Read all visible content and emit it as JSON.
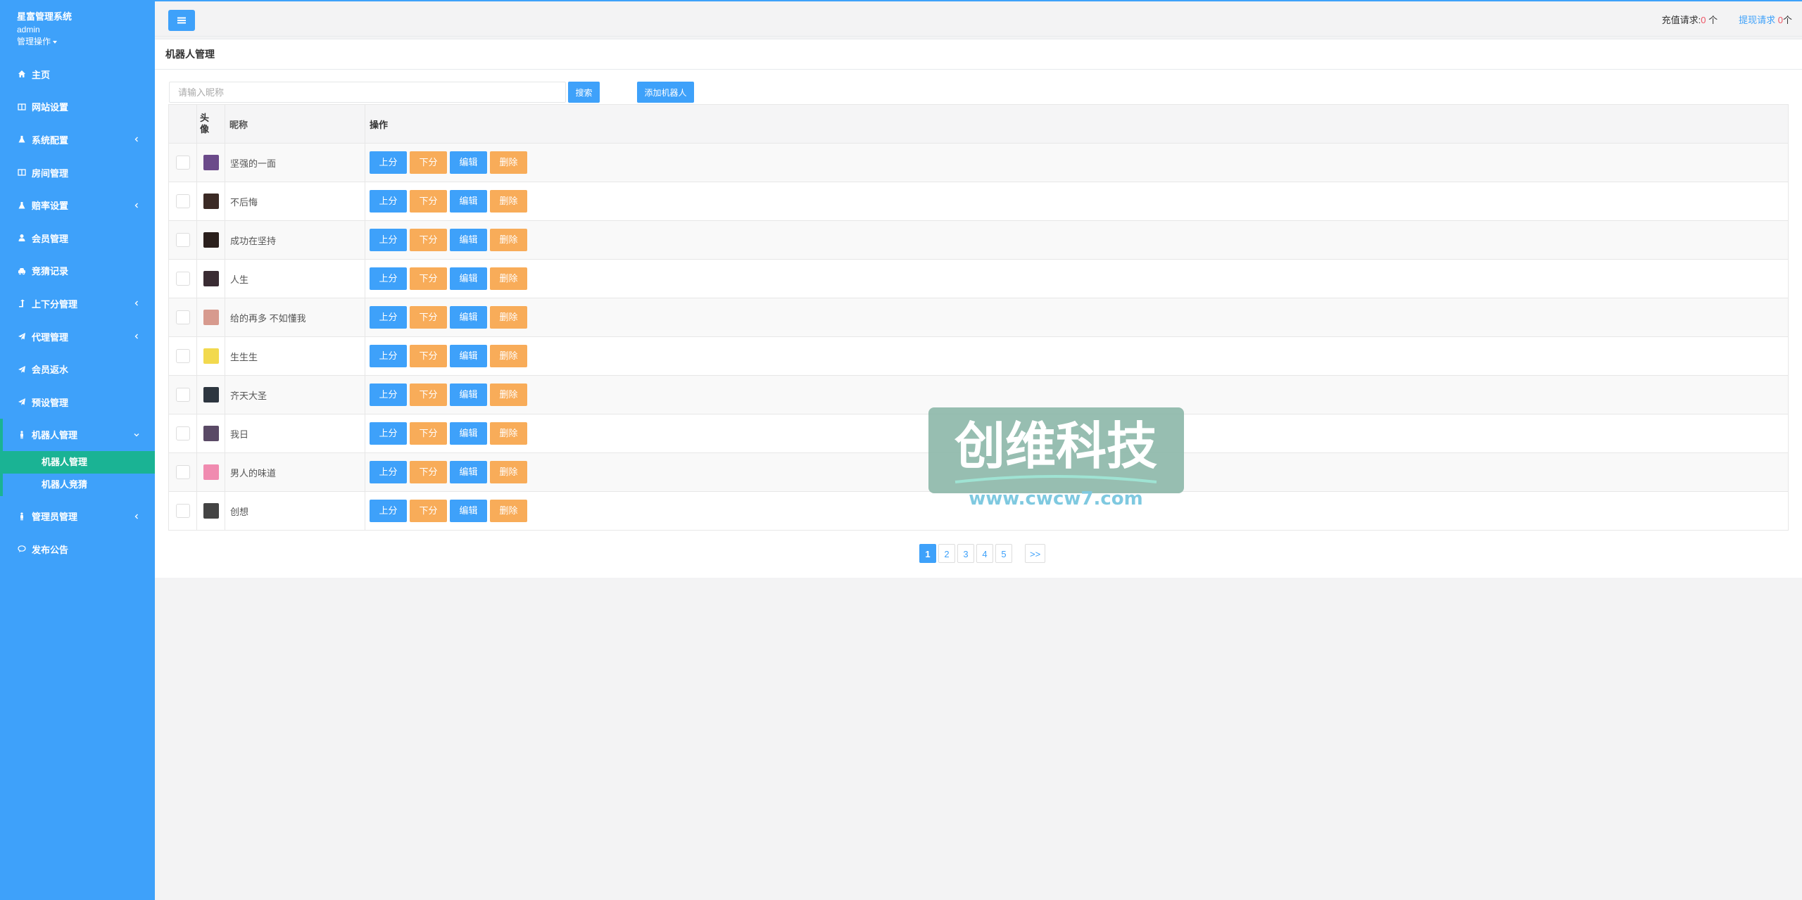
{
  "sidebar": {
    "system_name": "星富管理系统",
    "user": "admin",
    "menu_op": "管理操作",
    "items": [
      {
        "label": "主页",
        "icon": "home-icon",
        "has_arrow": false
      },
      {
        "label": "网站设置",
        "icon": "columns-icon",
        "has_arrow": false
      },
      {
        "label": "系统配置",
        "icon": "flask-icon",
        "has_arrow": true
      },
      {
        "label": "房间管理",
        "icon": "columns-icon",
        "has_arrow": false
      },
      {
        "label": "赔率设置",
        "icon": "flask-icon",
        "has_arrow": true
      },
      {
        "label": "会员管理",
        "icon": "user-icon",
        "has_arrow": false
      },
      {
        "label": "竞猜记录",
        "icon": "car-icon",
        "has_arrow": false
      },
      {
        "label": "上下分管理",
        "icon": "level-up-icon",
        "has_arrow": true
      },
      {
        "label": "代理管理",
        "icon": "paper-plane-icon",
        "has_arrow": true
      },
      {
        "label": "会员返水",
        "icon": "paper-plane-icon",
        "has_arrow": false
      },
      {
        "label": "预设管理",
        "icon": "paper-plane-icon",
        "has_arrow": false
      }
    ],
    "active_item": {
      "label": "机器人管理",
      "icon": "male-icon"
    },
    "sub_items": [
      "机器人管理",
      "机器人竞猜"
    ],
    "after_items": [
      {
        "label": "管理员管理",
        "icon": "male-icon",
        "has_arrow": true
      },
      {
        "label": "发布公告",
        "icon": "comment-icon",
        "has_arrow": false
      }
    ]
  },
  "topbar": {
    "recharge_label": "充值请求:",
    "recharge_count": "0",
    "recharge_unit": "个",
    "withdraw_label": "提现请求",
    "withdraw_count": "0",
    "withdraw_unit": "个"
  },
  "page": {
    "title": "机器人管理",
    "search_placeholder": "请输入昵称",
    "search_button": "搜索",
    "add_button": "添加机器人"
  },
  "table": {
    "headers": {
      "avatar": "头像",
      "nickname": "昵称",
      "actions": "操作"
    },
    "action_labels": {
      "up": "上分",
      "down": "下分",
      "edit": "编辑",
      "delete": "删除"
    },
    "rows": [
      {
        "name": "坚强的一面",
        "avatar_color": "#6b4a8a"
      },
      {
        "name": "不后悔",
        "avatar_color": "#3b2a25"
      },
      {
        "name": "成功在坚持",
        "avatar_color": "#2a1f1c"
      },
      {
        "name": "人生",
        "avatar_color": "#3a2c33"
      },
      {
        "name": "给的再多 不如懂我",
        "avatar_color": "#d79a8e"
      },
      {
        "name": "生生生",
        "avatar_color": "#f2d94e"
      },
      {
        "name": "齐天大圣",
        "avatar_color": "#2d3640"
      },
      {
        "name": "我日",
        "avatar_color": "#5a4a66"
      },
      {
        "name": "男人的味道",
        "avatar_color": "#f08bb0"
      },
      {
        "name": "创想",
        "avatar_color": "#444444"
      }
    ]
  },
  "pagination": {
    "pages": [
      "1",
      "2",
      "3",
      "4",
      "5"
    ],
    "current": "1",
    "next": ">>"
  },
  "watermark": {
    "title": "创维科技",
    "url": "www.cwcw7.com"
  },
  "colors": {
    "primary": "#3ea1fa",
    "accent_green": "#1ab394",
    "warning": "#f8ac59",
    "danger_text": "#ed5565"
  }
}
